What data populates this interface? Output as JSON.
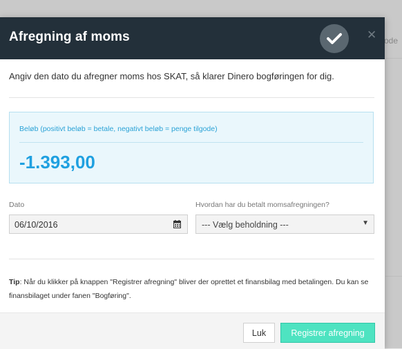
{
  "background": {
    "peek_text": "ode"
  },
  "modal": {
    "title": "Afregning af moms",
    "intro": "Angiv den dato du afregner moms hos SKAT, så klarer Dinero bogføringen for dig.",
    "amount": {
      "label": "Beløb (positivt beløb = betale, negativt beløb = penge tilgode)",
      "value": "-1.393,00"
    },
    "date_field": {
      "label": "Dato",
      "value": "06/10/2016"
    },
    "payment_field": {
      "label": "Hvordan har du betalt momsafregningen?",
      "selected": "--- Vælg beholdning ---"
    },
    "tip": {
      "prefix": "Tip",
      "text": ": Når du klikker på knappen \"Registrer afregning\" bliver der oprettet et finansbilag med betalingen. Du kan se finansbilaget under fanen \"Bogføring\"."
    },
    "buttons": {
      "close": "Luk",
      "register": "Registrer afregning"
    }
  },
  "colors": {
    "header_bg": "#23303a",
    "amount_text": "#1fa0e0",
    "primary_button": "#4ee3c1"
  }
}
